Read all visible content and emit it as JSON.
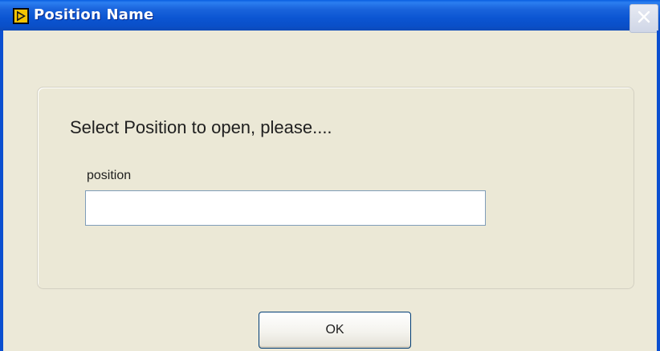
{
  "window": {
    "title": "Position Name",
    "icon": "labview-run-icon",
    "close_icon": "close-icon"
  },
  "dialog": {
    "prompt": "Select Position to open, please....",
    "field": {
      "label": "position",
      "value": "",
      "placeholder": ""
    },
    "ok_label": "OK"
  },
  "colors": {
    "titlebar": "#0b55d2",
    "background": "#ece9d8",
    "close_button": "#cfd6e6"
  }
}
